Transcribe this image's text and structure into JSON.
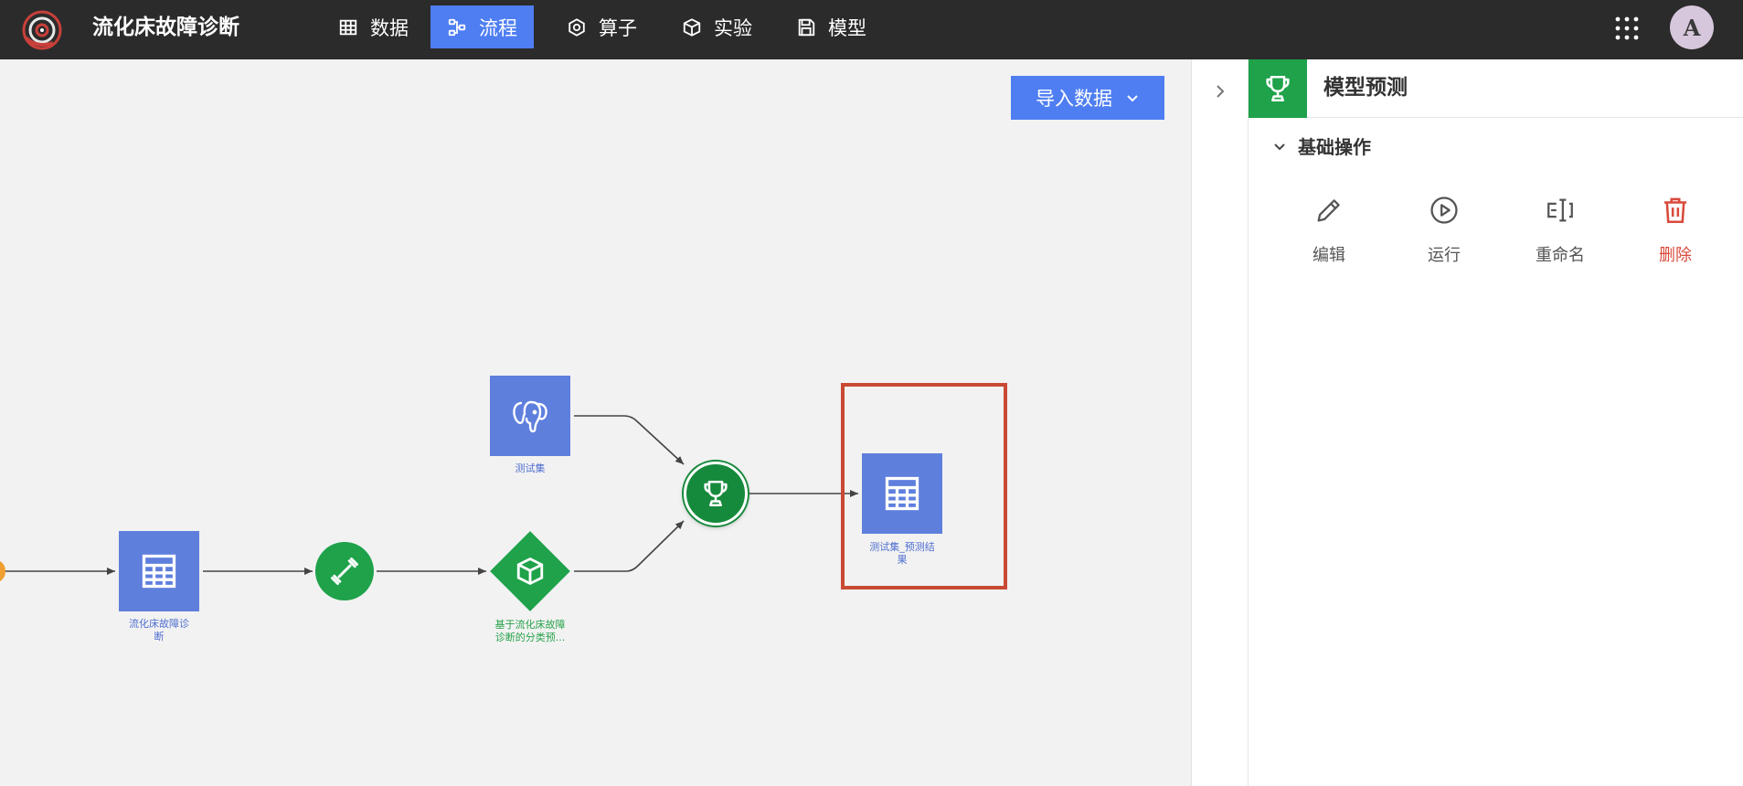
{
  "app": {
    "title": "流化床故障诊断",
    "avatar_letter": "A"
  },
  "nav": [
    {
      "key": "data",
      "label": "数据",
      "icon": "table-icon",
      "active": false
    },
    {
      "key": "flow",
      "label": "流程",
      "icon": "flow-icon",
      "active": true
    },
    {
      "key": "operator",
      "label": "算子",
      "icon": "hexagon-icon",
      "active": false
    },
    {
      "key": "experiment",
      "label": "实验",
      "icon": "cube-icon",
      "active": false
    },
    {
      "key": "model",
      "label": "模型",
      "icon": "save-icon",
      "active": false
    }
  ],
  "canvas": {
    "import_button": "导入数据",
    "nodes": {
      "dataset": {
        "label_line1": "流化床故障诊",
        "label_line2": "断",
        "icon": "table-icon"
      },
      "train": {
        "icon": "dumbbell-icon"
      },
      "model": {
        "label_line1": "基于流化床故障",
        "label_line2": "诊断的分类预...",
        "icon": "cube-icon"
      },
      "testset": {
        "label": "测试集",
        "icon": "postgres-icon"
      },
      "predict": {
        "icon": "trophy-icon"
      },
      "result": {
        "label_line1": "测试集_预测结",
        "label_line2": "果",
        "icon": "table-icon"
      }
    }
  },
  "panel": {
    "title": "模型预测",
    "title_icon": "trophy-icon",
    "section": "基础操作",
    "actions": [
      {
        "key": "edit",
        "label": "编辑",
        "icon": "pencil-icon"
      },
      {
        "key": "run",
        "label": "运行",
        "icon": "play-circle-icon"
      },
      {
        "key": "rename",
        "label": "重命名",
        "icon": "rename-icon"
      },
      {
        "key": "delete",
        "label": "删除",
        "icon": "trash-icon"
      }
    ]
  },
  "colors": {
    "topbar": "#2b2b2b",
    "accent_blue": "#4f7ef2",
    "node_blue": "#5f7fdd",
    "node_green": "#1fa24a",
    "selection_red": "#c94a33",
    "danger": "#d94a3c"
  }
}
